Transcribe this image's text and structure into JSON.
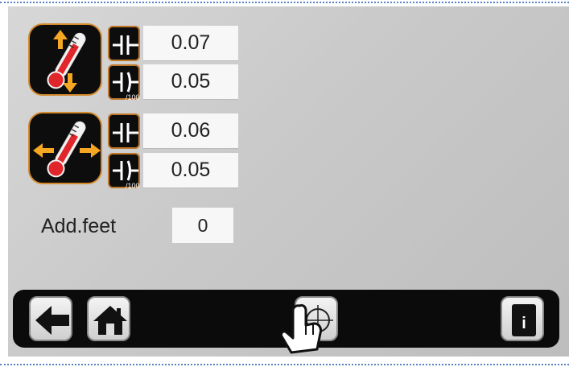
{
  "thermo_groups": [
    {
      "direction": "vertical",
      "icon": "thermometer-vertical-arrows-icon",
      "rows": [
        {
          "icon": "capacitor-icon",
          "value": "0.07"
        },
        {
          "icon": "capacitor-per-100-icon",
          "icon_text": "/100",
          "value": "0.05"
        }
      ]
    },
    {
      "direction": "horizontal",
      "icon": "thermometer-horizontal-arrows-icon",
      "rows": [
        {
          "icon": "capacitor-icon",
          "value": "0.06"
        },
        {
          "icon": "capacitor-per-100-icon",
          "icon_text": "/100",
          "value": "0.05"
        }
      ]
    }
  ],
  "add_feet": {
    "label": "Add.feet",
    "value": "0"
  },
  "toolbar": {
    "back_icon": "arrow-left-icon",
    "home_icon": "home-icon",
    "target_icon": "crosshair-target-icon",
    "info_icon": "info-icon",
    "info_text": "i"
  },
  "overlay": {
    "icon": "pointing-hand-icon"
  },
  "colors": {
    "accent": "#d38a2d",
    "arrow": "#f5a623",
    "thermometer": "#e0262b",
    "panel": "#0d0d0d",
    "background": "#c9c9c9"
  }
}
